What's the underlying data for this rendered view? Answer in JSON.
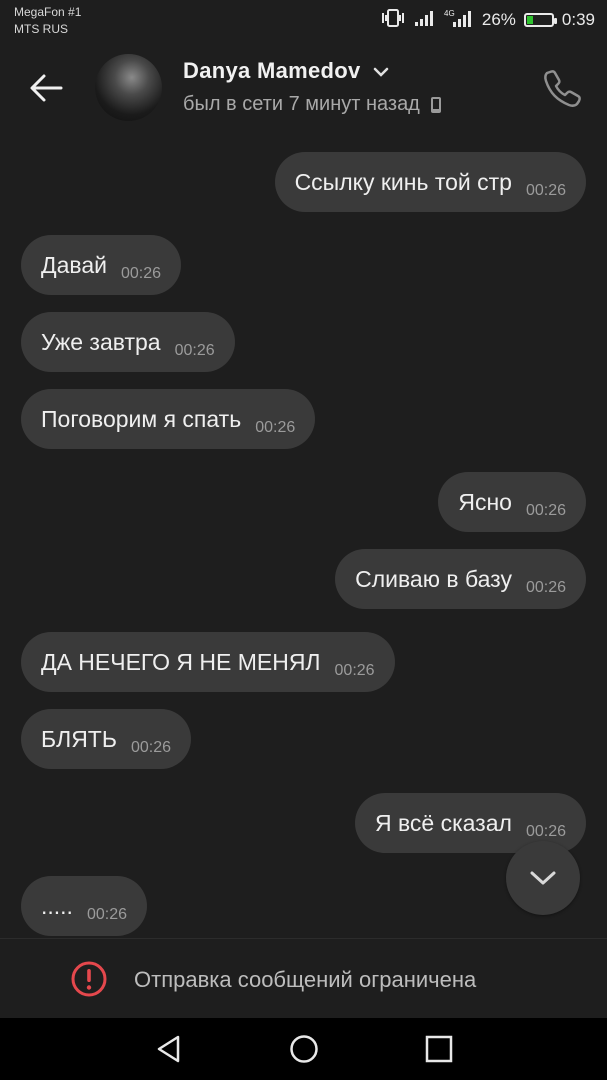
{
  "status_bar": {
    "carrier_1": "MegaFon #1",
    "carrier_2": "MTS RUS",
    "battery_percent": "26%",
    "battery_level": 0.26,
    "time": "0:39",
    "icons": [
      "vibrate-icon",
      "signal-icon",
      "signal-4g-icon",
      "battery-icon"
    ]
  },
  "header": {
    "contact_name": "Danya Mamedov",
    "presence": "был в сети 7 минут назад",
    "icons": [
      "back-arrow-icon",
      "chevron-down-icon",
      "mobile-device-icon",
      "phone-icon"
    ]
  },
  "messages": [
    {
      "side": "out",
      "text": "Ссылку кинь той стр",
      "time": "00:26"
    },
    {
      "side": "in",
      "text": "Давай",
      "time": "00:26"
    },
    {
      "side": "in",
      "text": "Уже завтра",
      "time": "00:26"
    },
    {
      "side": "in",
      "text": "Поговорим я спать",
      "time": "00:26"
    },
    {
      "side": "out",
      "text": "Ясно",
      "time": "00:26"
    },
    {
      "side": "out",
      "text": "Сливаю в базу",
      "time": "00:26"
    },
    {
      "side": "in",
      "text": "ДА НЕЧЕГО Я НЕ МЕНЯЛ",
      "time": "00:26"
    },
    {
      "side": "in",
      "text": "БЛЯТЬ",
      "time": "00:26"
    },
    {
      "side": "out",
      "text": "Я всё сказал",
      "time": "00:26"
    },
    {
      "side": "in",
      "text": ".....",
      "time": "00:26"
    }
  ],
  "restriction": {
    "text": "Отправка сообщений ограничена",
    "icon": "warning-icon"
  },
  "navigation": {
    "icons": [
      "nav-back-icon",
      "nav-home-icon",
      "nav-recents-icon"
    ]
  },
  "colors": {
    "background": "#1e1e1e",
    "bubble": "#3a3a3a",
    "warning": "#e5484d",
    "battery_fill": "#2ec12e"
  }
}
